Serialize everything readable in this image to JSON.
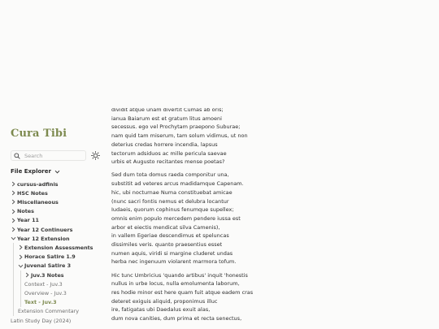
{
  "site": {
    "title": "Cura Tibi"
  },
  "search": {
    "placeholder": "Search"
  },
  "explorer": {
    "title": "File Explorer",
    "items": [
      {
        "label": "cursus-adfinis",
        "kind": "folder",
        "depth": 0,
        "expanded": false
      },
      {
        "label": "HSC Notes",
        "kind": "folder",
        "depth": 0,
        "expanded": false
      },
      {
        "label": "Miscellaneous",
        "kind": "folder",
        "depth": 0,
        "expanded": false
      },
      {
        "label": "Notes",
        "kind": "folder",
        "depth": 0,
        "expanded": false
      },
      {
        "label": "Year 11",
        "kind": "folder",
        "depth": 0,
        "expanded": false
      },
      {
        "label": "Year 12 Continuers",
        "kind": "folder",
        "depth": 0,
        "expanded": false
      },
      {
        "label": "Year 12 Extension",
        "kind": "folder",
        "depth": 0,
        "expanded": true
      },
      {
        "label": "Extension Assessments",
        "kind": "folder",
        "depth": 1,
        "expanded": false
      },
      {
        "label": "Horace Satire 1.9",
        "kind": "folder",
        "depth": 1,
        "expanded": false
      },
      {
        "label": "Juvenal Satire 3",
        "kind": "folder",
        "depth": 1,
        "expanded": true
      },
      {
        "label": "Juv.3 Notes",
        "kind": "folder",
        "depth": 2,
        "expanded": false
      },
      {
        "label": "Context - Juv.3",
        "kind": "file",
        "depth": 2
      },
      {
        "label": "Overview - Juv.3",
        "kind": "file",
        "depth": 2
      },
      {
        "label": "Text - Juv.3",
        "kind": "file",
        "depth": 2,
        "active": true
      },
      {
        "label": "Extension Commentary",
        "kind": "file",
        "depth": 1
      },
      {
        "label": "Latin Study Day (2024)",
        "kind": "file",
        "depth": 0
      }
    ]
  },
  "text": {
    "stanzas": [
      [
        "dividit atque unam divertit Cumas ab oris;",
        "ianua Baiarum est et gratum litus amoeni",
        "secessus. ego vel Prochytam praepono Suburae;",
        "nam quid tam miserum, tam solum vidimus, ut non",
        "deterius credas horrere incendia, lapsus",
        "tectorum adsiduos ac mille pericula saevae",
        "urbis et Augusto recitantes mense poetas?"
      ],
      [
        "Sed dum tota domus raeda componitur una,",
        "substitit ad veteres arcus madidamque Capenam.",
        "hic, ubi nocturnae Numa constituebat amicae",
        "(nunc sacri fontis nemus et delubra locantur",
        "Iudaeis, quorum cophinus fenumque supellex;",
        "omnis enim populo mercedem pendere iussa est",
        "arbor et eiectis mendicat silva Camenis),",
        "in vallem Egeriae descendimus et speluncas",
        "dissimiles veris. quanto praesentius esset",
        "numen aquis, viridi si margine cluderet undas",
        "herba nec ingenuum violarent marmora tofum."
      ],
      [
        "Hic tunc Umbricius 'quando artibus' inquit 'honestis",
        "nullus in urbe locus, nulla emolumenta laborum,",
        "res hodie minor est here quam fuit atque eadem cras",
        "deteret exiguis aliquid, proponimus illuc",
        "ire, fatigatas ubi Daedalus exuit alas,",
        "dum nova canities, dum prima et recta senectus,"
      ]
    ]
  },
  "colors": {
    "accent": "#7d8a4f",
    "background": "#fbfbfa",
    "text": "#2d2d2d"
  }
}
